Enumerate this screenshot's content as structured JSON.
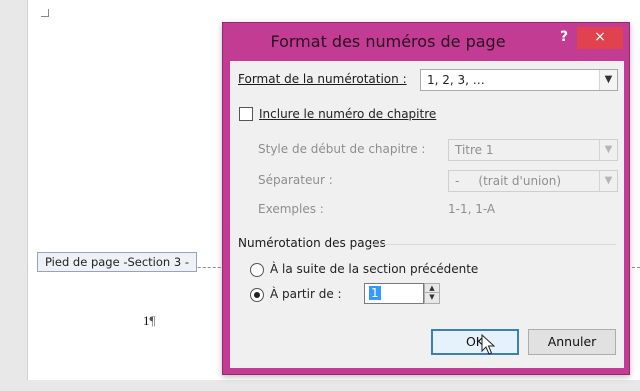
{
  "document": {
    "footer_label": "Pied de page -Section 3 -",
    "page_number": "1"
  },
  "dialog": {
    "title": "Format des numéros de page",
    "help": "?",
    "close": "×",
    "format_label": "Format de la numérotation :",
    "format_value": "1, 2, 3, …",
    "include_chapter": "Inclure le numéro de chapitre",
    "chapter_style_label": "Style de début de chapitre :",
    "chapter_style_value": "Titre 1",
    "separator_label": "Séparateur :",
    "separator_value": "-     (trait d'union)",
    "examples_label": "Exemples :",
    "examples_value": "1-1, 1-A",
    "page_numbering_title": "Numérotation des pages",
    "continue_option": "À la suite de la section précédente",
    "start_at_label": "À partir de :",
    "start_at_value": "1",
    "ok": "OK",
    "cancel": "Annuler"
  },
  "colors": {
    "titlebar": "#c33c93",
    "close_button": "#e0434f"
  }
}
